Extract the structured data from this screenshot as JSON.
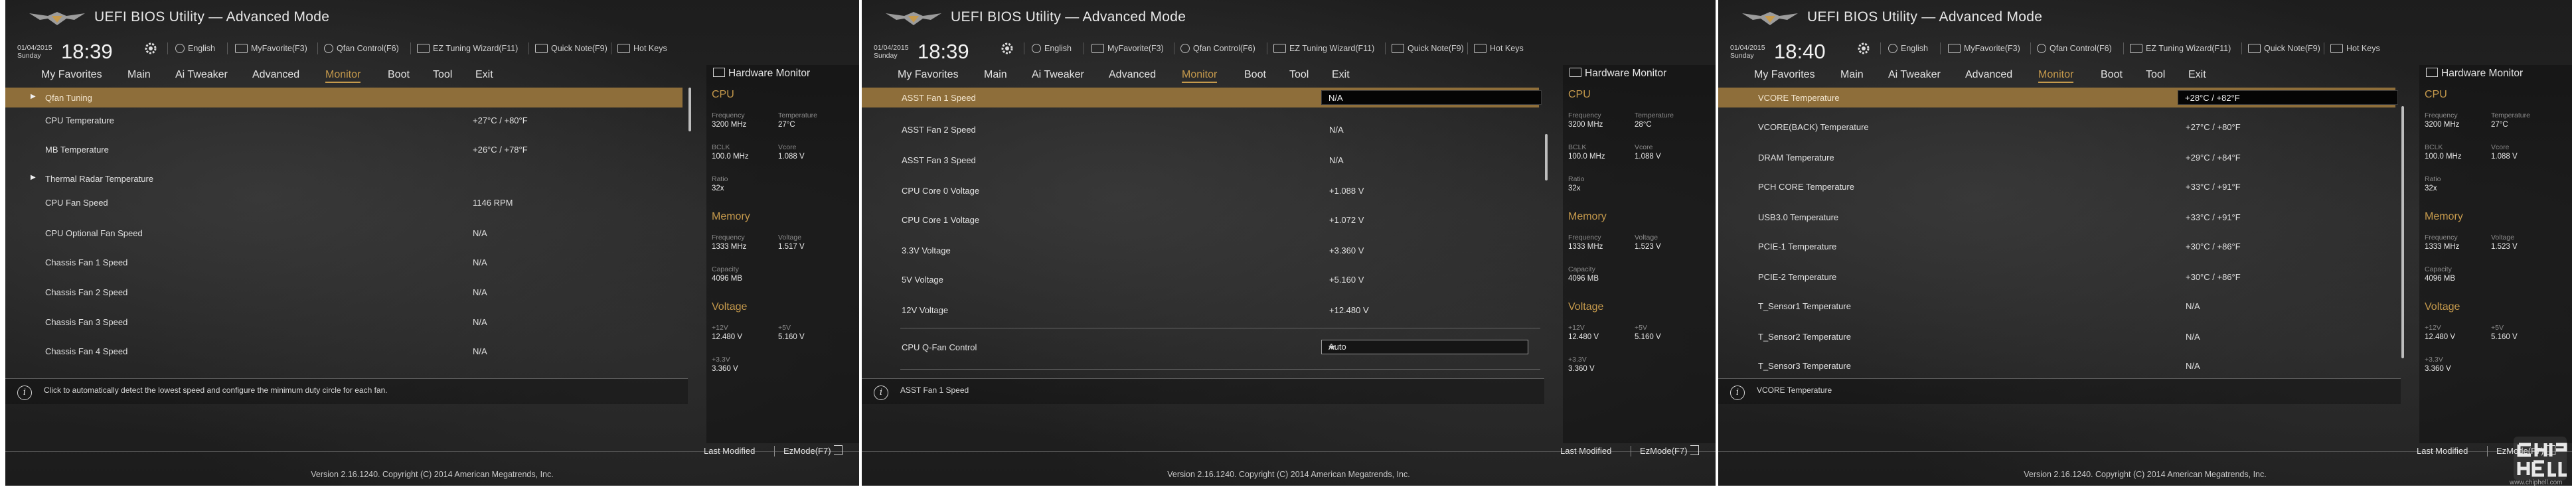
{
  "title": "UEFI BIOS Utility — Advanced Mode",
  "screens": [
    {
      "date": "01/04/2015",
      "day": "Sunday",
      "time": "18:39",
      "rows_type": "p0"
    },
    {
      "date": "01/04/2015",
      "day": "Sunday",
      "time": "18:39"
    },
    {
      "date": "01/04/2015",
      "day": "Sunday",
      "time": "18:40"
    }
  ],
  "toolbar": {
    "language": "English",
    "myfavorite": "MyFavorite(F3)",
    "qfan": "Qfan Control(F6)",
    "ez_tuning": "EZ Tuning Wizard(F11)",
    "quick_note": "Quick Note(F9)",
    "hot_keys": "Hot Keys"
  },
  "nav": {
    "my_favorites": "My Favorites",
    "main": "Main",
    "ai_tweaker": "Ai Tweaker",
    "advanced": "Advanced",
    "monitor": "Monitor",
    "boot": "Boot",
    "tool": "Tool",
    "exit": "Exit"
  },
  "panel1": {
    "qfan_tuning": "Qfan Tuning",
    "cpu_temp": "CPU Temperature",
    "cpu_temp_val": "+27°C / +80°F",
    "mb_temp": "MB Temperature",
    "mb_temp_val": "+26°C / +78°F",
    "thermal_radar": "Thermal Radar Temperature",
    "cpu_fan": "CPU Fan Speed",
    "cpu_fan_val": "1146 RPM",
    "cpu_opt_fan": "CPU Optional Fan Speed",
    "cpu_opt_fan_val": "N/A",
    "chassis1": "Chassis Fan 1 Speed",
    "chassis1_val": "N/A",
    "chassis2": "Chassis Fan 2 Speed",
    "chassis2_val": "N/A",
    "chassis3": "Chassis Fan 3 Speed",
    "chassis3_val": "N/A",
    "chassis4": "Chassis Fan 4 Speed",
    "chassis4_val": "N/A",
    "help": "Click to automatically detect the lowest speed and configure the minimum duty circle for each fan."
  },
  "panel2": {
    "asst1": "ASST Fan 1 Speed",
    "asst1_val": "N/A",
    "asst2": "ASST Fan 2 Speed",
    "asst2_val": "N/A",
    "asst3": "ASST Fan 3 Speed",
    "asst3_val": "N/A",
    "core0": "CPU Core 0 Voltage",
    "core0_val": "+1.088 V",
    "core1": "CPU Core 1 Voltage",
    "core1_val": "+1.072 V",
    "v33": "3.3V Voltage",
    "v33_val": "+3.360 V",
    "v5": "5V Voltage",
    "v5_val": "+5.160 V",
    "v12": "12V Voltage",
    "v12_val": "+12.480 V",
    "qfan_ctrl": "CPU Q-Fan Control",
    "qfan_ctrl_val": "Auto",
    "help": "ASST Fan 1 Speed"
  },
  "panel3": {
    "vcore": "VCORE Temperature",
    "vcore_val": "+28°C / +82°F",
    "vcore_back": "VCORE(BACK) Temperature",
    "vcore_back_val": "+27°C / +80°F",
    "dram": "DRAM Temperature",
    "dram_val": "+29°C / +84°F",
    "pch": "PCH CORE Temperature",
    "pch_val": "+33°C / +91°F",
    "usb": "USB3.0 Temperature",
    "usb_val": "+33°C / +91°F",
    "pcie1": "PCIE-1 Temperature",
    "pcie1_val": "+30°C / +86°F",
    "pcie2": "PCIE-2 Temperature",
    "pcie2_val": "+30°C / +86°F",
    "ts1": "T_Sensor1 Temperature",
    "ts1_val": "N/A",
    "ts2": "T_Sensor2 Temperature",
    "ts2_val": "N/A",
    "ts3": "T_Sensor3 Temperature",
    "ts3_val": "N/A",
    "help": "VCORE Temperature"
  },
  "hw": {
    "title": "Hardware Monitor",
    "cpu": "CPU",
    "frequency": "Frequency",
    "frequency_val": "3200 MHz",
    "temperature": "Temperature",
    "temperature_val": "27°C",
    "temperature_val_2": "28°C",
    "bclk": "BCLK",
    "bclk_val": "100.0 MHz",
    "vcore": "Vcore",
    "vcore_val": "1.088 V",
    "ratio": "Ratio",
    "ratio_val": "32x",
    "memory": "Memory",
    "mem_freq": "Frequency",
    "mem_freq_val": "1333 MHz",
    "mem_volt": "Voltage",
    "mem_volt_val": "1.517 V",
    "mem_volt_val_2": "1.523 V",
    "capacity": "Capacity",
    "capacity_val": "4096 MB",
    "voltage": "Voltage",
    "p12": "+12V",
    "p12_val": "12.480 V",
    "p5": "+5V",
    "p5_val": "5.160 V",
    "p33": "+3.3V",
    "p33_val": "3.360 V"
  },
  "footer": {
    "last_modified": "Last Modified",
    "ezmode": "EzMode(F7)",
    "version": "Version 2.16.1240. Copyright (C) 2014 American Megatrends, Inc."
  },
  "watermark": {
    "url": "www.chiphell.com"
  },
  "colors": {
    "accent": "#c69a4c",
    "highlight_row": "#8e6e3a"
  }
}
